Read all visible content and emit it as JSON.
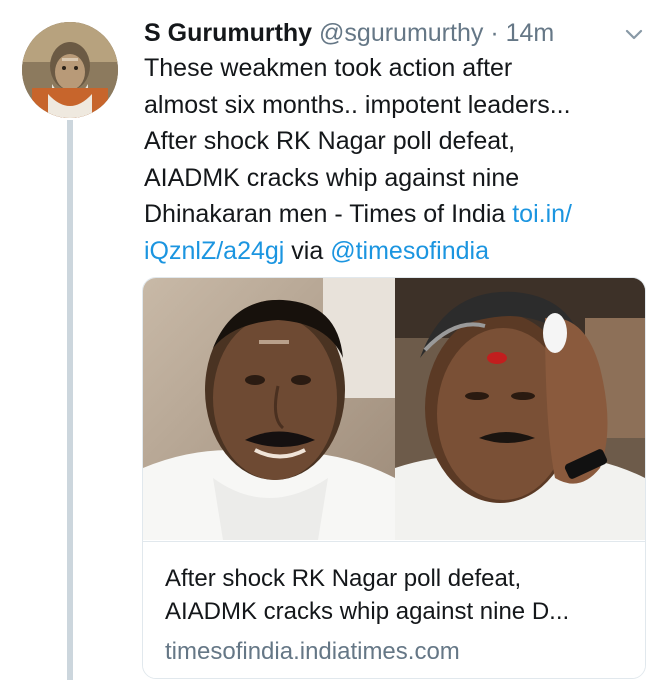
{
  "tweet": {
    "author_name": "S Gurumurthy",
    "author_handle": "@sgurumurthy",
    "separator": "·",
    "time": "14m",
    "text_lines": [
      "These weakmen took action after",
      "almost six months.. impotent leaders...",
      "After shock RK Nagar poll defeat,",
      "AIADMK cracks whip against nine"
    ],
    "line5_prefix": "Dhinakaran men - Times of India ",
    "line5_link": "toi.in/",
    "line6_link": "iQznlZ/a24gj",
    "line6_via": " via ",
    "line6_mention": "@timesofindia"
  },
  "card": {
    "title_lines": [
      "After shock RK Nagar poll defeat,",
      "AIADMK cracks whip against nine D..."
    ],
    "domain": "timesofindia.indiatimes.com"
  },
  "colors": {
    "link": "#1b95e0",
    "secondary_text": "#657786",
    "thread_line": "#ccd6dd",
    "card_border": "#e1e8ed"
  },
  "icons": [
    "avatar",
    "chevron-down-icon"
  ]
}
